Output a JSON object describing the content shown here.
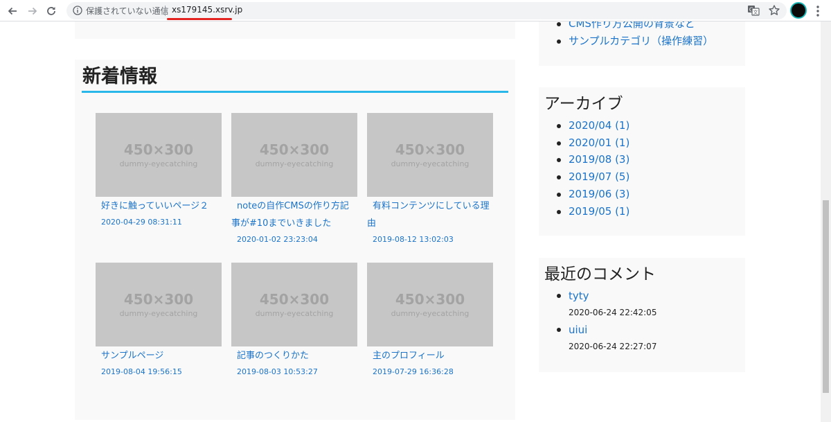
{
  "browser": {
    "status_text": "保護されていない通信",
    "url": "xs179145.xsrv.jp",
    "icons": [
      "back-arrow-icon",
      "forward-arrow-icon",
      "reload-icon",
      "info-icon",
      "translate-icon",
      "star-icon",
      "profile-avatar",
      "menu-dots-icon"
    ],
    "accent_color": "#e3231f"
  },
  "main": {
    "news_heading": "新着情報",
    "posts": [
      {
        "image_dim": "450×300",
        "image_label": "dummy-eyecatching",
        "title": "好きに触っていいページ２",
        "date": "2020-04-29 08:31:11"
      },
      {
        "image_dim": "450×300",
        "image_label": "dummy-eyecatching",
        "title": "noteの自作CMSの作り方記事が#10までいきました",
        "date": "2020-01-02 23:23:04"
      },
      {
        "image_dim": "450×300",
        "image_label": "dummy-eyecatching",
        "title": "有料コンテンツにしている理由",
        "date": "2019-08-12 13:02:03"
      },
      {
        "image_dim": "450×300",
        "image_label": "dummy-eyecatching",
        "title": "サンプルページ",
        "date": "2019-08-04 19:56:15"
      },
      {
        "image_dim": "450×300",
        "image_label": "dummy-eyecatching",
        "title": "記事のつくりかた",
        "date": "2019-08-03 10:53:27"
      },
      {
        "image_dim": "450×300",
        "image_label": "dummy-eyecatching",
        "title": "主のプロフィール",
        "date": "2019-07-29 16:36:28"
      }
    ]
  },
  "sidebar": {
    "categories": [
      "CMS作り方公開の背景など",
      "サンプルカテゴリ（操作練習）"
    ],
    "archive": {
      "heading": "アーカイブ",
      "items": [
        "2020/04 (1)",
        "2020/01 (1)",
        "2019/08 (3)",
        "2019/07 (5)",
        "2019/06 (3)",
        "2019/05 (1)"
      ]
    },
    "comments": {
      "heading": "最近のコメント",
      "items": [
        {
          "name": "tyty",
          "date": "2020-06-24 22:42:05"
        },
        {
          "name": "uiui",
          "date": "2020-06-24 22:27:07"
        }
      ]
    }
  },
  "colors": {
    "link": "#1a73c9",
    "heading_underline": "#29b6e8",
    "panel_bg": "#f9f9f9",
    "thumb_bg": "#c6c6c6"
  }
}
